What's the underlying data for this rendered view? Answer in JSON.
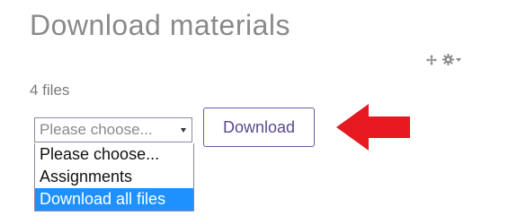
{
  "page": {
    "title": "Download materials",
    "file_count": "4 files"
  },
  "tools": {
    "move_icon": "move-icon",
    "settings_icon": "gear-icon"
  },
  "select": {
    "value": "Please choose...",
    "options": [
      {
        "label": "Please choose...",
        "selected": false
      },
      {
        "label": "Assignments",
        "selected": false
      },
      {
        "label": "Download all files",
        "selected": true
      }
    ]
  },
  "download_button": {
    "label": "Download"
  },
  "annotation": {
    "arrow_color": "#e5191f"
  }
}
